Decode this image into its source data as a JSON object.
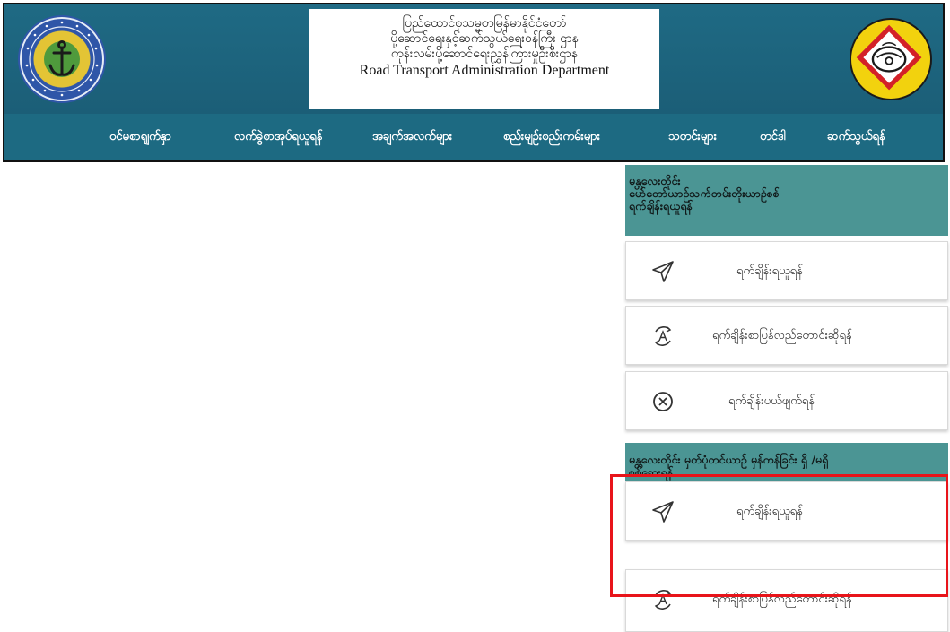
{
  "header": {
    "title_lines": [
      "ပြည်ထောင်စုသမ္မတမြန်မာနိုင်ငံတော်",
      "ပို့ဆောင်ရေးနှင့်ဆက်သွယ်ရေးဝန်ကြီး ဌာန",
      "ကုန်းလမ်းပို့ဆောင်ရေးညွှန်ကြားမှုဦးစီးဌာန",
      "Road Transport Administration Department"
    ],
    "left_logo": "ministry-of-transport-and-communications-seal",
    "right_logo": "road-transport-administration-department-logo",
    "colors": {
      "banner": "#1b5e77",
      "nav": "#1d6a82",
      "nav_text": "#ffffff"
    }
  },
  "nav": {
    "items": [
      "ဝင်မစာရျက်နှာ",
      "လက်ခွဲစာအုပ်ရယူရန်",
      "အချက်အလက်များ",
      "စည်းမျဉ်းစည်းကမ်းများ",
      "သတင်းများ",
      "တင်ဒါ",
      "ဆက်သွယ်ရန်"
    ]
  },
  "sections": [
    {
      "heading_lines": [
        "မန္တလေးတိုင်း",
        "မော်တော်ယာဉ်သက်တမ်းတိုးယာဉ်စစ်",
        "ရက်ချိန်းရယူရန်"
      ],
      "cards": [
        {
          "icon": "send-icon",
          "label": "ရက်ချိန်းရယူရန်"
        },
        {
          "icon": "refresh-icon",
          "label": "ရက်ချိန်းစာပြန်လည်တောင်းဆိုရန်"
        },
        {
          "icon": "cancel-icon",
          "label": "ရက်ချိန်းပယ်ဖျက်ရန်"
        }
      ]
    },
    {
      "heading_lines": [
        "မန္တလေးတိုင်း မှတ်ပုံတင်ယာဉ် မှန်ကန်ခြင်း ရှိ /မရှိ",
        "စစ်ဆေးရန်"
      ],
      "cards": [
        {
          "icon": "send-icon",
          "label": "ရက်ချိန်းရယူရန်"
        },
        {
          "icon": "refresh-icon",
          "label": "ရက်ချိန်းစာပြန်လည်တောင်းဆိုရန်"
        }
      ]
    }
  ],
  "colors": {
    "section_heading_bg": "#4b9594",
    "highlight": "#e8141a"
  }
}
